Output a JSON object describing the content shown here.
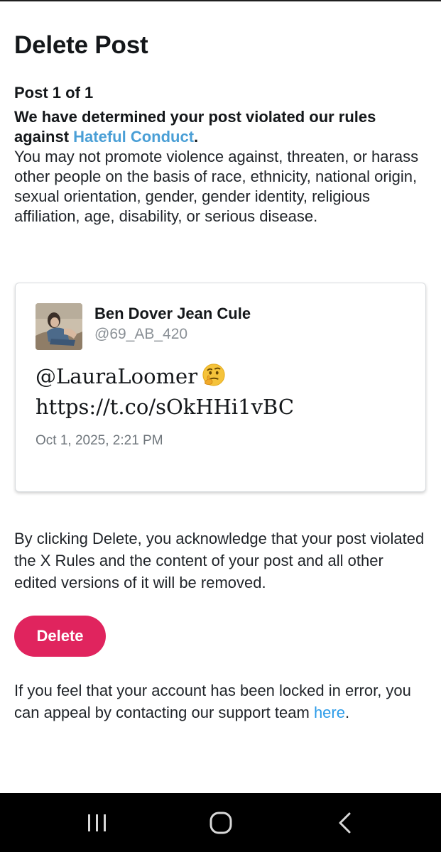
{
  "page": {
    "title": "Delete Post",
    "post_counter": "Post 1 of 1"
  },
  "violation": {
    "prefix": "We have determined your post violated our rules against ",
    "rule_link": "Hateful Conduct",
    "suffix": ".",
    "description": "You may not promote violence against, threaten, or harass other people on the basis of race, ethnicity, national origin, sexual orientation, gender, gender identity, religious affiliation, age, disability, or serious disease."
  },
  "tweet": {
    "author_name": "Ben Dover Jean Cule",
    "author_handle": "@69_AB_420",
    "text_line1": "@LauraLoomer",
    "emoji_icon": "thinking-face-icon",
    "text_line2": "https://t.co/sOkHHi1vBC",
    "timestamp": "Oct 1, 2025, 2:21 PM"
  },
  "acknowledgement": "By clicking Delete, you acknowledge that your post violated the X Rules and the content of your post and all other edited versions of it will be removed.",
  "actions": {
    "delete_label": "Delete"
  },
  "appeal": {
    "text": "If you feel that your account has been locked in error, you can appeal by contacting our support team ",
    "link": "here",
    "suffix": "."
  },
  "nav_bar": {
    "recents_icon": "recents-icon",
    "home_icon": "home-icon",
    "back_icon": "back-icon"
  },
  "colors": {
    "link": "#4a9fd6",
    "delete_button": "#e0245e",
    "nav_bar": "#000000"
  }
}
